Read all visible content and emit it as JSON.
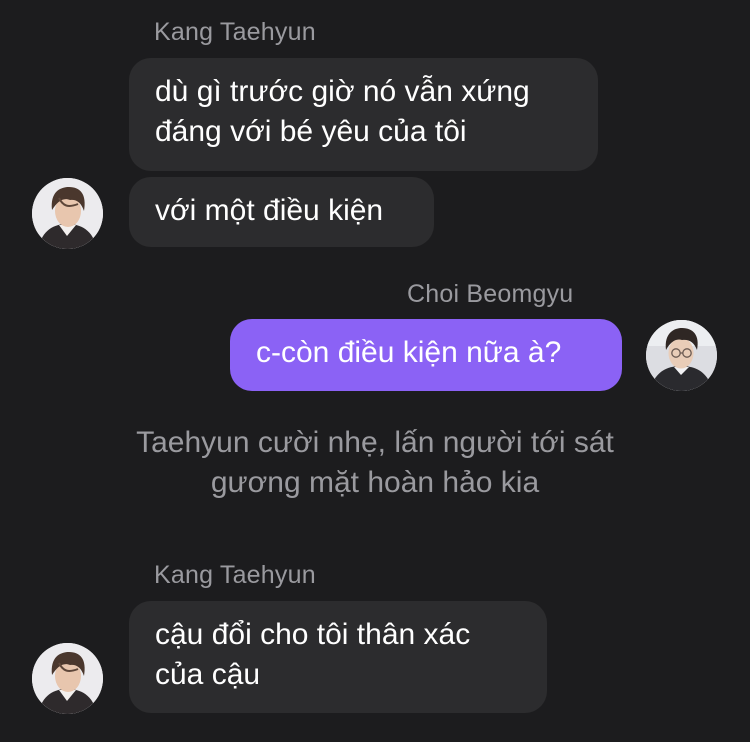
{
  "chat": {
    "group1": {
      "sender": "Kang Taehyun",
      "bubble1": "dù gì trước giờ nó vẫn xứng đáng với bé yêu của tôi",
      "bubble2": "với một điều kiện"
    },
    "group2": {
      "sender": "Choi Beomgyu",
      "bubble1": "c-còn điều kiện nữa à?"
    },
    "narration": {
      "line1": "Taehyun cười nhẹ, lấn người tới sát",
      "line2": "gương mặt hoàn hảo kia"
    },
    "group3": {
      "sender": "Kang Taehyun",
      "bubble1": "cậu đổi cho tôi thân xác của cậu"
    }
  },
  "colors": {
    "background": "#1c1c1e",
    "incoming_bubble": "#2c2c2e",
    "outgoing_bubble": "#8b62f5",
    "secondary_text": "#9a9a9f"
  },
  "icons": {
    "taehyun_avatar": "avatar-photo-taehyun",
    "beomgyu_avatar": "avatar-photo-beomgyu"
  }
}
